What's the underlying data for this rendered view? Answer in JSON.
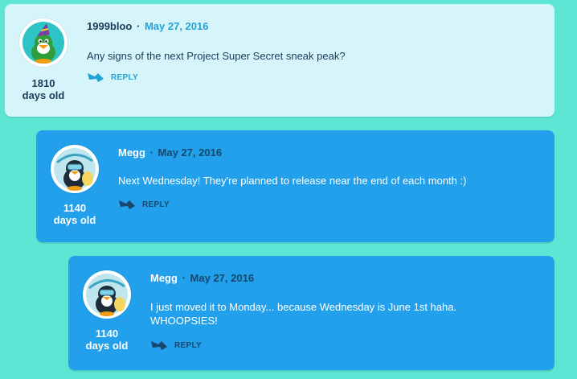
{
  "colors": {
    "page_background": "#5ee6d4",
    "light_card": "#d6f5fb",
    "blue_card": "#22a0ec",
    "accent_cyan": "#23a3d8",
    "dark_navy": "#1c3b5a"
  },
  "comments": [
    {
      "username": "1999bloo",
      "separator": "·",
      "date": "May 27, 2016",
      "text": "Any signs of the next Project Super Secret sneak peak?",
      "days_count": "1810",
      "days_label": "days old",
      "reply_label": "REPLY",
      "avatar_icon": "green-penguin-party-hat-avatar"
    },
    {
      "username": "Megg",
      "separator": "·",
      "date": "May 27, 2016",
      "text": "Next Wednesday! They're planned to release near the end of each month :)",
      "days_count": "1140",
      "days_label": "days old",
      "reply_label": "REPLY",
      "avatar_icon": "penguin-diver-avatar"
    },
    {
      "username": "Megg",
      "separator": "·",
      "date": "May 27, 2016",
      "text": "I just moved it to Monday... because Wednesday is June 1st haha. WHOOPSIES!",
      "days_count": "1140",
      "days_label": "days old",
      "reply_label": "REPLY",
      "avatar_icon": "penguin-diver-avatar"
    }
  ]
}
